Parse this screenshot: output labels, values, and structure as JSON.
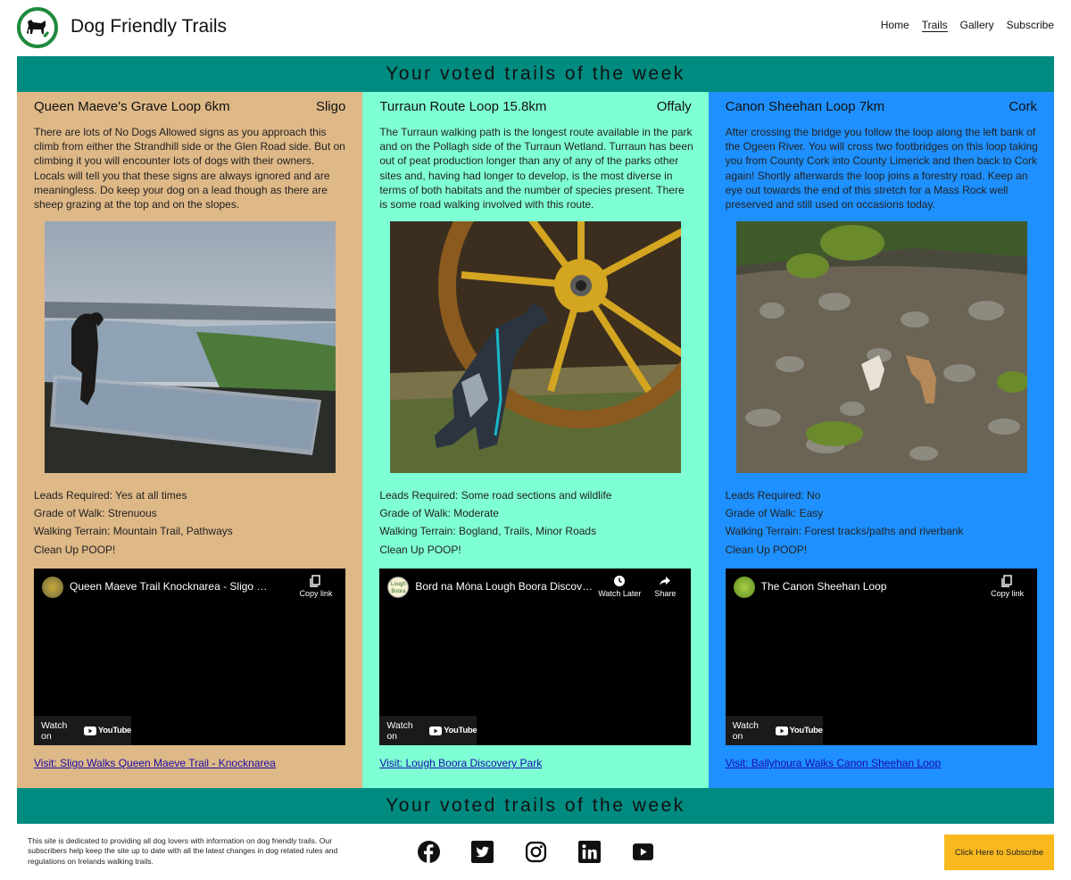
{
  "header": {
    "brand": "Dog Friendly Trails",
    "logo_icon": "dog-logo-icon",
    "nav": [
      {
        "label": "Home",
        "active": false
      },
      {
        "label": "Trails",
        "active": true
      },
      {
        "label": "Gallery",
        "active": false
      },
      {
        "label": "Subscribe",
        "active": false
      }
    ]
  },
  "banner": {
    "top_text": "Your voted trails of the week",
    "bottom_text": "Your voted trails of the week",
    "color": "#008b80"
  },
  "trails": [
    {
      "title": "Queen Maeve's Grave Loop 6km",
      "county": "Sligo",
      "background": "#deb887",
      "description": "There are lots of No Dogs Allowed signs as you approach this climb from either the Strandhill side or the Glen Road side. But on climbing it you will encounter lots of dogs with their owners. Locals will tell you that these signs are always ignored and are meaningless. Do keep your dog on a lead though as there are sheep grazing at the top and on the slopes.",
      "photo_icon": "dog-at-viewpoint-photo",
      "facts": [
        "Leads Required: Yes at all times",
        "Grade of Walk: Strenuous",
        "Walking Terrain: Mountain Trail, Pathways",
        "Clean Up POOP!"
      ],
      "video": {
        "title": "Queen Maeve Trail Knocknarea - Sligo Walks",
        "actions": [
          {
            "label": "Copy link",
            "icon": "copy-icon"
          }
        ],
        "watch_on": "Watch on",
        "platform": "YouTube"
      },
      "link_text": "Visit: Sligo Walks Queen Maeve Trail - Knocknarea"
    },
    {
      "title": "Turraun Route Loop 15.8km",
      "county": "Offaly",
      "background": "#7fffd4",
      "description": "The Turraun walking path is the longest route available in the park and on the Pollagh side of the Turraun Wetland. Turraun has been out of peat production longer than any of any of the parks other sites and, having had longer to develop, is the most diverse in terms of both habitats and the number of species present. There is some road walking involved with this route.",
      "photo_icon": "dog-by-wheel-photo",
      "facts": [
        "Leads Required: Some road sections and wildlife",
        "Grade of Walk: Moderate",
        "Walking Terrain: Bogland, Trails, Minor Roads",
        "Clean Up POOP!"
      ],
      "video": {
        "title": "Bord na Móna Lough Boora Discovery ...",
        "actions": [
          {
            "label": "Watch Later",
            "icon": "clock-icon"
          },
          {
            "label": "Share",
            "icon": "share-icon"
          }
        ],
        "watch_on": "Watch on",
        "platform": "YouTube",
        "channel_label": "Lough Boora"
      },
      "link_text": "Visit: Lough Boora Discovery Park"
    },
    {
      "title": "Canon Sheehan Loop 7km",
      "county": "Cork",
      "background": "#1e90ff",
      "description": "After crossing the bridge you follow the loop along the left bank of the Ogeen River. You will cross two footbridges on this loop taking you from County Cork into County Limerick and then back to Cork again! Shortly afterwards the loop joins a forestry road. Keep an eye out towards the end of this stretch for a Mass Rock well preserved and still used on occasions today.",
      "photo_icon": "dogs-in-river-photo",
      "facts": [
        "Leads Required: No",
        "Grade of Walk: Easy",
        "Walking Terrain: Forest tracks/paths and riverbank",
        "Clean Up POOP!"
      ],
      "video": {
        "title": "The Canon Sheehan Loop",
        "actions": [
          {
            "label": "Copy link",
            "icon": "copy-icon"
          }
        ],
        "watch_on": "Watch on",
        "platform": "YouTube"
      },
      "link_text": "Visit: Ballyhoura Walks Canon Sheehan Loop"
    }
  ],
  "footer": {
    "text": "This site is dedicated to providing all dog lovers with information on dog friendly trails. Our subscribers help keep the site up to date with all the latest changes in dog related rules and regulations on Irelands walking trails.",
    "socials": [
      "facebook-icon",
      "twitter-icon",
      "instagram-icon",
      "linkedin-icon",
      "youtube-icon"
    ],
    "subscribe_label": "Click Here to Subscribe",
    "subscribe_color": "#f9b91e"
  }
}
